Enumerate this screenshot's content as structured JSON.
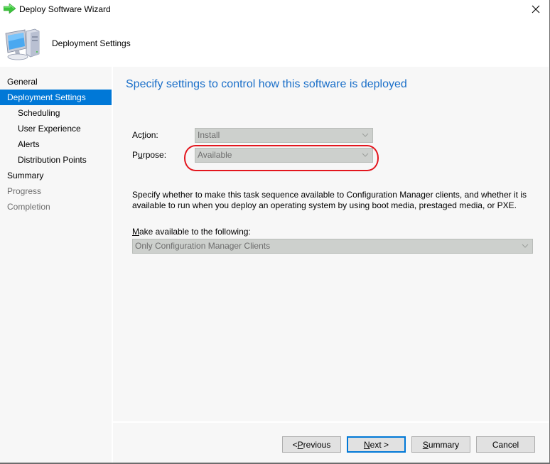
{
  "window": {
    "title": "Deploy Software Wizard",
    "title_icon": "green-arrow-icon",
    "close_icon": "close-icon"
  },
  "header": {
    "title": "Deployment Settings",
    "icon": "computer-icon"
  },
  "sidebar": {
    "items": [
      {
        "label": "General",
        "level": 0,
        "state": "normal"
      },
      {
        "label": "Deployment Settings",
        "level": 0,
        "state": "active"
      },
      {
        "label": "Scheduling",
        "level": 1,
        "state": "normal"
      },
      {
        "label": "User Experience",
        "level": 1,
        "state": "normal"
      },
      {
        "label": "Alerts",
        "level": 1,
        "state": "normal"
      },
      {
        "label": "Distribution Points",
        "level": 1,
        "state": "normal"
      },
      {
        "label": "Summary",
        "level": 0,
        "state": "normal"
      },
      {
        "label": "Progress",
        "level": 0,
        "state": "disabled"
      },
      {
        "label": "Completion",
        "level": 0,
        "state": "disabled"
      }
    ]
  },
  "main": {
    "page_title": "Specify settings to control how this software is deployed",
    "action": {
      "label_pre": "Ac",
      "label_key": "t",
      "label_post": "ion:",
      "value": "Install",
      "enabled": false
    },
    "purpose": {
      "label_pre": "P",
      "label_key": "u",
      "label_post": "rpose:",
      "value": "Available",
      "enabled": false,
      "highlighted": true,
      "highlight_color": "#e3161e"
    },
    "description": "Specify whether to make this task sequence available to Configuration Manager clients, and whether it is available to run when you deploy an operating system by using boot media, prestaged media, or PXE.",
    "make_available": {
      "label_key": "M",
      "label_post": "ake available to the following:",
      "value": "Only Configuration Manager Clients",
      "enabled": false
    }
  },
  "footer": {
    "previous": {
      "pre": "< ",
      "key": "P",
      "post": "revious"
    },
    "next": {
      "pre": "",
      "key": "N",
      "post": "ext >"
    },
    "summary": {
      "pre": "",
      "key": "S",
      "post": "ummary"
    },
    "cancel": {
      "label": "Cancel"
    }
  },
  "colors": {
    "accent": "#0078d7",
    "title_blue": "#1a6fc9",
    "disabled_text": "#6d6d6d",
    "disabled_field": "#cdd0cd"
  }
}
